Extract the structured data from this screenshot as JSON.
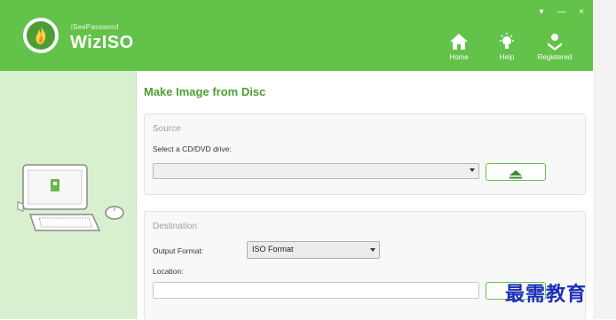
{
  "app": {
    "brand_small": "iSeePassword",
    "brand_name": "WizISO"
  },
  "window_controls": {
    "dropdown": "▾",
    "minimize": "—",
    "close": "×"
  },
  "header_nav": [
    {
      "label": "Home",
      "icon": "home-icon"
    },
    {
      "label": "Help",
      "icon": "lightbulb-icon"
    },
    {
      "label": "Registered",
      "icon": "registered-user-icon"
    }
  ],
  "page": {
    "title": "Make Image from Disc",
    "source": {
      "title": "Source",
      "drive_label": "Select a CD/DVD drive:",
      "drive_value": "",
      "eject_icon": "eject-icon"
    },
    "destination": {
      "title": "Destination",
      "format_label": "Output Format:",
      "format_value": "ISO Format",
      "location_label": "Location:",
      "location_value": ""
    }
  },
  "illustration": "computer-illustration-icon",
  "watermark": "最需教育",
  "colors": {
    "brand_green": "#63c24a",
    "dark_green": "#4a9e33",
    "left_panel": "#d9f0cf",
    "watermark_blue": "#1d2fb8"
  }
}
